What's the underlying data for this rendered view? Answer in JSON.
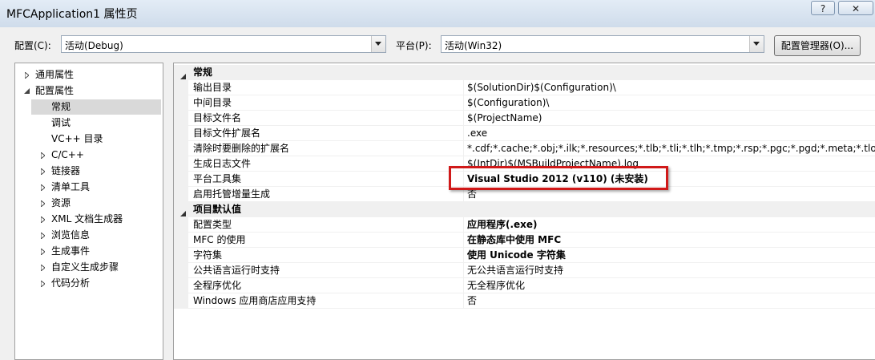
{
  "window": {
    "title": "MFCApplication1 属性页",
    "help_label": "?",
    "close_label": "✕"
  },
  "toolbar": {
    "config_label": "配置(C):",
    "config_value": "活动(Debug)",
    "platform_label": "平台(P):",
    "platform_value": "活动(Win32)",
    "config_manager_label": "配置管理器(O)..."
  },
  "tree": {
    "items": [
      {
        "label": "通用属性",
        "expander": "collapsed",
        "level": 0
      },
      {
        "label": "配置属性",
        "expander": "expanded",
        "level": 0
      },
      {
        "label": "常规",
        "expander": "none",
        "level": 1,
        "selected": true
      },
      {
        "label": "调试",
        "expander": "none",
        "level": 1
      },
      {
        "label": "VC++ 目录",
        "expander": "none",
        "level": 1
      },
      {
        "label": "C/C++",
        "expander": "collapsed",
        "level": 1
      },
      {
        "label": "链接器",
        "expander": "collapsed",
        "level": 1
      },
      {
        "label": "清单工具",
        "expander": "collapsed",
        "level": 1
      },
      {
        "label": "资源",
        "expander": "collapsed",
        "level": 1
      },
      {
        "label": "XML 文档生成器",
        "expander": "collapsed",
        "level": 1
      },
      {
        "label": "浏览信息",
        "expander": "collapsed",
        "level": 1
      },
      {
        "label": "生成事件",
        "expander": "collapsed",
        "level": 1
      },
      {
        "label": "自定义生成步骤",
        "expander": "collapsed",
        "level": 1
      },
      {
        "label": "代码分析",
        "expander": "collapsed",
        "level": 1
      }
    ]
  },
  "grid": {
    "categories": [
      {
        "title": "常规",
        "properties": [
          {
            "name": "输出目录",
            "value": "$(SolutionDir)$(Configuration)\\",
            "bold": false
          },
          {
            "name": "中间目录",
            "value": "$(Configuration)\\",
            "bold": false
          },
          {
            "name": "目标文件名",
            "value": "$(ProjectName)",
            "bold": false
          },
          {
            "name": "目标文件扩展名",
            "value": ".exe",
            "bold": false
          },
          {
            "name": "清除时要删除的扩展名",
            "value": "*.cdf;*.cache;*.obj;*.ilk;*.resources;*.tlb;*.tli;*.tlh;*.tmp;*.rsp;*.pgc;*.pgd;*.meta;*.tlog;*.ma",
            "bold": false
          },
          {
            "name": "生成日志文件",
            "value": "$(IntDir)$(MSBuildProjectName).log",
            "bold": false
          },
          {
            "name": "平台工具集",
            "value": "Visual Studio 2012 (v110) (未安装)",
            "bold": true
          },
          {
            "name": "启用托管增量生成",
            "value": "否",
            "bold": false
          }
        ]
      },
      {
        "title": "项目默认值",
        "properties": [
          {
            "name": "配置类型",
            "value": "应用程序(.exe)",
            "bold": true
          },
          {
            "name": "MFC 的使用",
            "value": "在静态库中使用 MFC",
            "bold": true
          },
          {
            "name": "字符集",
            "value": "使用 Unicode 字符集",
            "bold": true
          },
          {
            "name": "公共语言运行时支持",
            "value": "无公共语言运行时支持",
            "bold": false
          },
          {
            "name": "全程序优化",
            "value": "无全程序优化",
            "bold": false
          },
          {
            "name": "Windows 应用商店应用支持",
            "value": "否",
            "bold": false
          }
        ]
      }
    ]
  },
  "colors": {
    "highlight_border": "#d01919",
    "selection": "#d9d9d9"
  }
}
